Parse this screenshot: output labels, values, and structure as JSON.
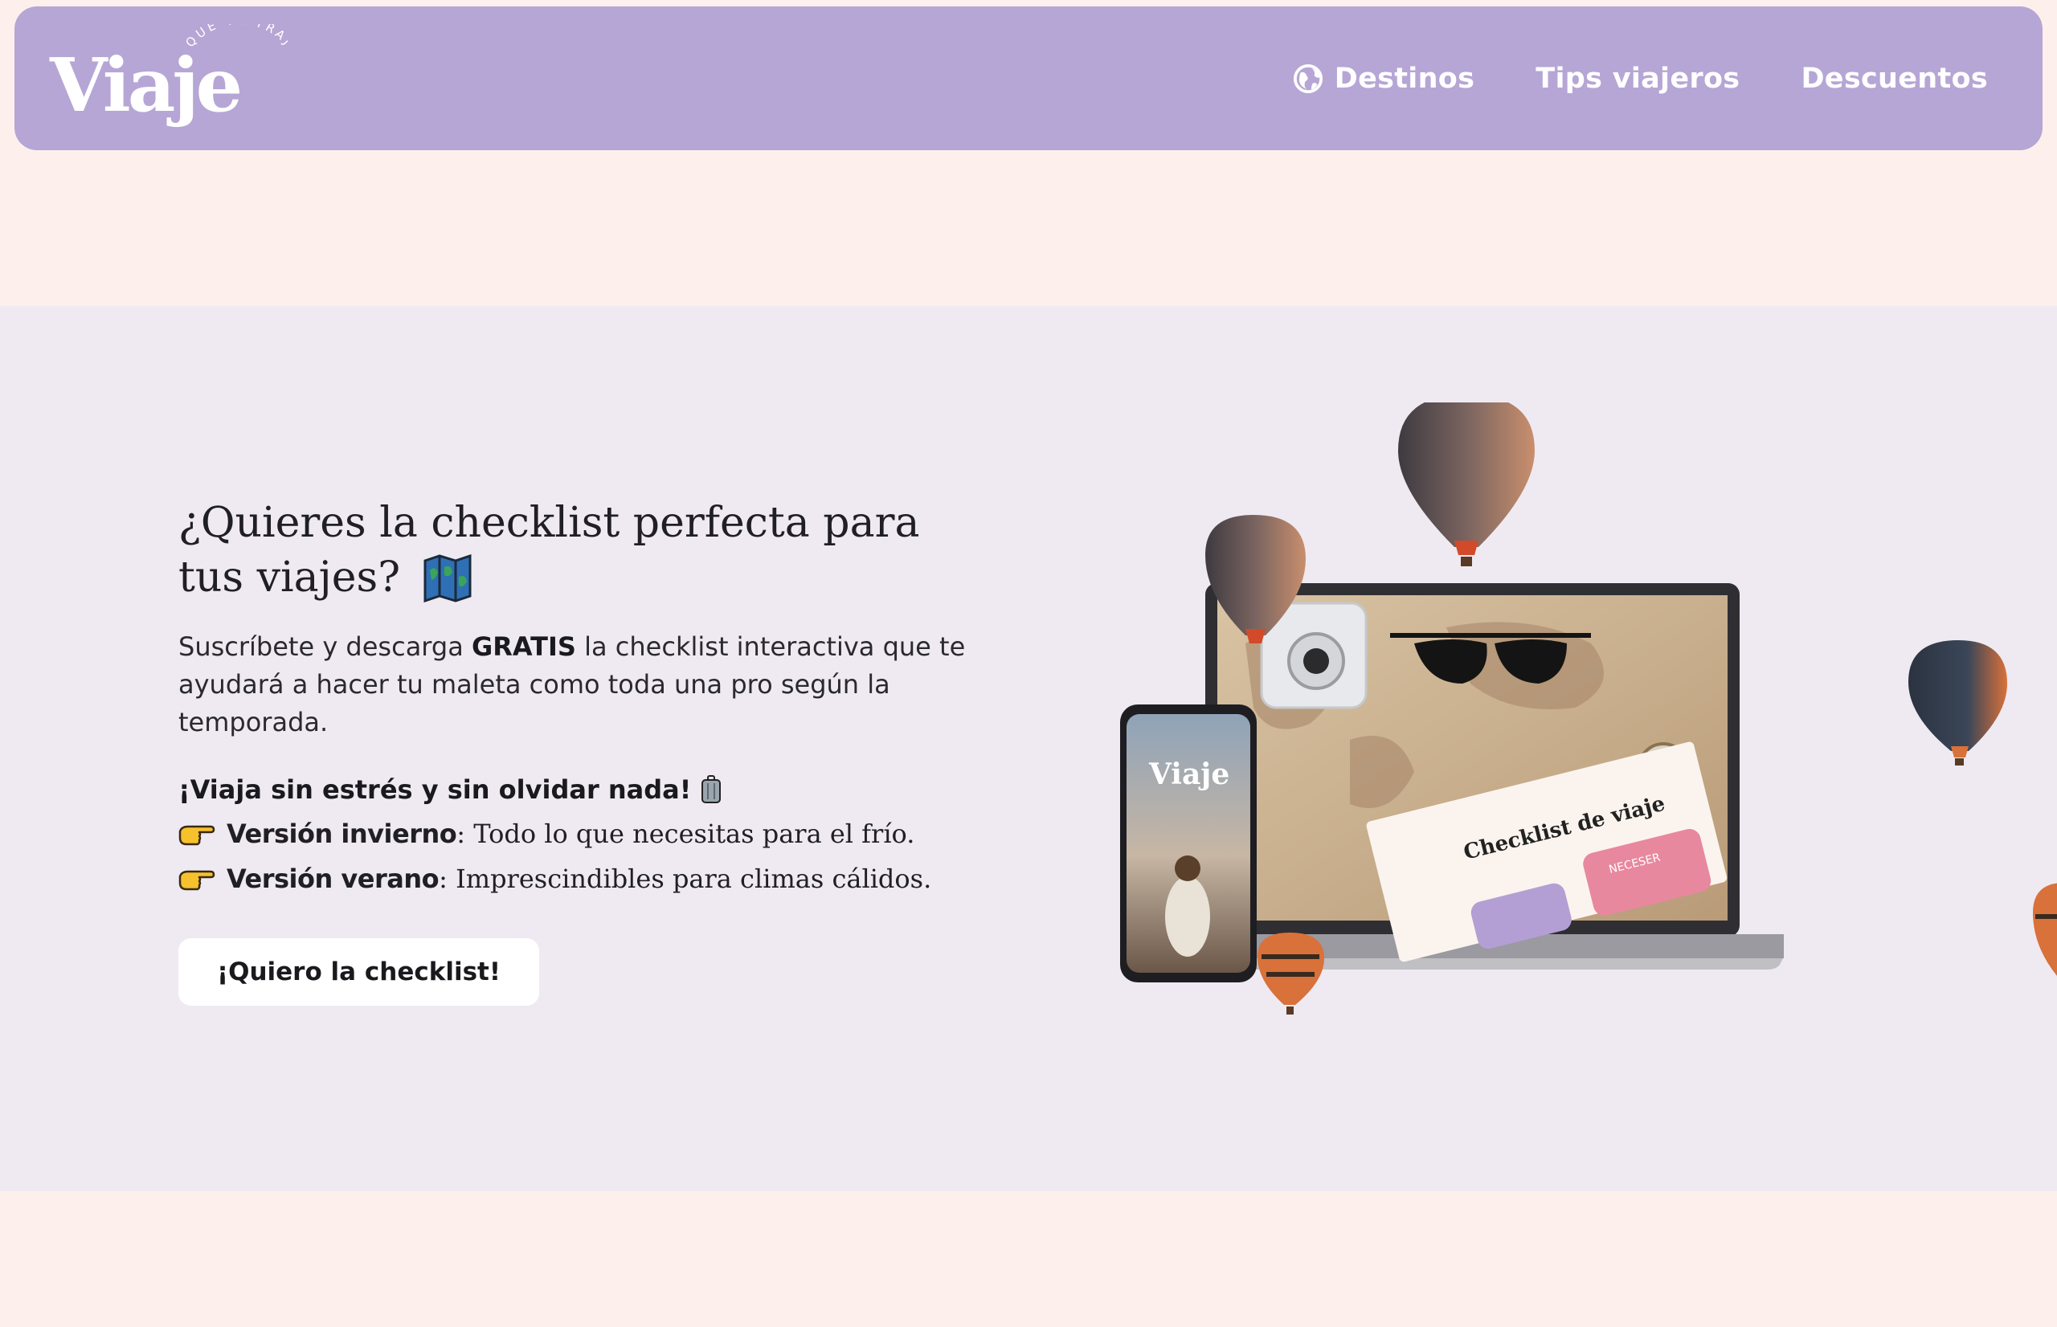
{
  "header": {
    "logo": {
      "wordmark": "Viaje",
      "tagline": "QUE TE TRAJE"
    },
    "nav": [
      {
        "label": "Destinos",
        "icon": "globe-icon"
      },
      {
        "label": "Tips viajeros"
      },
      {
        "label": "Descuentos"
      }
    ]
  },
  "hero": {
    "headline": "¿Quieres la checklist perfecta para tus viajes?",
    "headline_icon": "map-icon",
    "lead_before": "Suscríbete y descarga ",
    "lead_strong": "GRATIS",
    "lead_after": " la checklist interactiva que te ayudará a hacer tu maleta como toda una pro según la temporada.",
    "tagline": "¡Viaja sin estrés y sin olvidar nada!",
    "tagline_icon": "suitcase-icon",
    "versions": [
      {
        "name": "Versión invierno",
        "description": ": Todo lo que necesitas para el frío.",
        "icon": "pointing-hand-icon"
      },
      {
        "name": "Versión verano",
        "description": ": Imprescindibles para climas cálidos.",
        "icon": "pointing-hand-icon"
      }
    ],
    "cta_label": "¡Quiero la checklist!"
  },
  "illustration": {
    "phone_logo": "Viaje",
    "checklist_title": "Checklist de viaje",
    "checklist_card": "NECESER"
  },
  "colors": {
    "page_bg": "#fdf0ec",
    "header_bg": "#b6a6d5",
    "hero_bg": "#efeaf2",
    "text": "#1f1f24"
  }
}
